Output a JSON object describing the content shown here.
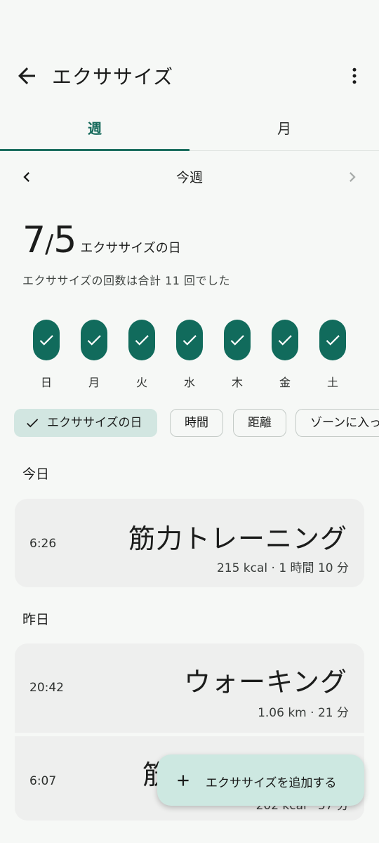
{
  "app_bar": {
    "title": "エクササイズ",
    "back_icon": "arrow-back-icon",
    "more_icon": "more-vert-icon"
  },
  "tabs": [
    {
      "label": "週",
      "selected": true
    },
    {
      "label": "月",
      "selected": false
    }
  ],
  "week_nav": {
    "label": "今週",
    "prev_icon": "chevron-left-icon",
    "next_icon": "chevron-right-icon"
  },
  "summary": {
    "done": "7",
    "separator": "/",
    "goal": "5",
    "suffix": "エクササイズの日",
    "subtitle": "エクササイズの回数は合計 11 回でした"
  },
  "days": [
    {
      "label": "日",
      "done": true
    },
    {
      "label": "月",
      "done": true
    },
    {
      "label": "火",
      "done": true
    },
    {
      "label": "水",
      "done": true
    },
    {
      "label": "木",
      "done": true
    },
    {
      "label": "金",
      "done": true
    },
    {
      "label": "土",
      "done": true
    }
  ],
  "chips": [
    {
      "label": "エクササイズの日",
      "selected": true
    },
    {
      "label": "時間",
      "selected": false
    },
    {
      "label": "距離",
      "selected": false
    },
    {
      "label": "ゾーンに入っ",
      "selected": false
    }
  ],
  "sections": [
    {
      "heading": "今日",
      "entries": [
        {
          "time": "6:26",
          "title": "筋力トレーニング",
          "meta": "215 kcal · 1 時間 10 分"
        }
      ]
    },
    {
      "heading": "昨日",
      "entries": [
        {
          "time": "20:42",
          "title": "ウォーキング",
          "meta": "1.06 km · 21 分"
        },
        {
          "time": "6:07",
          "title": "筋",
          "meta": "202 kcal · 57 分"
        }
      ]
    }
  ],
  "fab": {
    "label": "エクササイズを追加する",
    "icon": "plus-icon"
  },
  "colors": {
    "accent": "#116b5c",
    "chip_selected": "#d2e6e1",
    "fab": "#cde8e1",
    "background": "#f6f8f6",
    "card": "#eeefee"
  }
}
